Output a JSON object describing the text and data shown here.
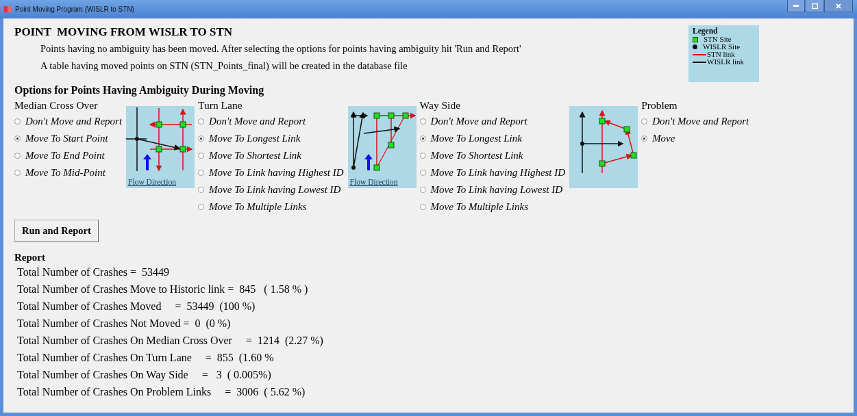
{
  "window": {
    "title": "Point Moving Program (WISLR to STN)"
  },
  "heading": "POINT  MOVING FROM WISLR TO STN",
  "notes": [
    "Points having no ambiguity has been moved. After selecting the options for points having ambiguity hit 'Run and Report'",
    "A table having moved points on STN (STN_Points_final) will be created in the database file"
  ],
  "legend": {
    "title": "Legend",
    "items": [
      {
        "kind": "square",
        "label": "STN Site"
      },
      {
        "kind": "dot",
        "label": "WISLR Site"
      },
      {
        "kind": "red-line",
        "label": "STN link"
      },
      {
        "kind": "black-line",
        "label": "WISLR link"
      }
    ]
  },
  "options_title": "Options for Points Having Ambiguity During Moving",
  "columns": [
    {
      "kind": "options",
      "title": "Median Cross Over",
      "options": [
        {
          "label": "Don't Move and Report",
          "selected": false
        },
        {
          "label": "Move To Start Point",
          "selected": true
        },
        {
          "label": "Move To End Point",
          "selected": false
        },
        {
          "label": "Move To Mid-Point",
          "selected": false
        }
      ]
    },
    {
      "kind": "median-diagram",
      "caption": "Flow Direction"
    },
    {
      "kind": "options",
      "title": "Turn Lane",
      "options": [
        {
          "label": "Don't Move and Report",
          "selected": false
        },
        {
          "label": "Move To Longest Link",
          "selected": true
        },
        {
          "label": "Move To Shortest Link",
          "selected": false
        },
        {
          "label": "Move To Link having Highest ID",
          "selected": false
        },
        {
          "label": "Move To Link having Lowest ID",
          "selected": false
        },
        {
          "label": "Move To Multiple Links",
          "selected": false
        }
      ]
    },
    {
      "kind": "turn-diagram",
      "caption": "Flow Direction"
    },
    {
      "kind": "options",
      "title": "Way Side",
      "options": [
        {
          "label": "Don't Move and Report",
          "selected": false
        },
        {
          "label": "Move To Longest Link",
          "selected": true
        },
        {
          "label": "Move To Shortest Link",
          "selected": false
        },
        {
          "label": "Move To Link having Highest ID",
          "selected": false
        },
        {
          "label": "Move To Link having Lowest ID",
          "selected": false
        },
        {
          "label": "Move To Multiple Links",
          "selected": false
        }
      ]
    },
    {
      "kind": "problem-diagram"
    },
    {
      "kind": "options",
      "title": "Problem",
      "options": [
        {
          "label": "Don't Move and Report",
          "selected": false
        },
        {
          "label": "Move",
          "selected": true
        }
      ]
    }
  ],
  "run_button": "Run and Report",
  "report": {
    "title": "Report",
    "lines": [
      "Total Number of Crashes =  53449",
      "Total Number of Crashes Move to Historic link =  845   ( 1.58 % )",
      "Total Number of Crashes Moved     =  53449  (100 %)",
      "Total Number of Crashes Not Moved =  0  (0 %)",
      "Total Number of Crashes On Median Cross Over     =  1214  (2.27 %)",
      "Total Number of Crashes On Turn Lane     =  855  (1.60 %",
      "Total Number of Crashes On Way Side     =   3  ( 0.005%)",
      "Total Number of Crashes On Problem Links     =  3006  ( 5.62 %)"
    ]
  }
}
